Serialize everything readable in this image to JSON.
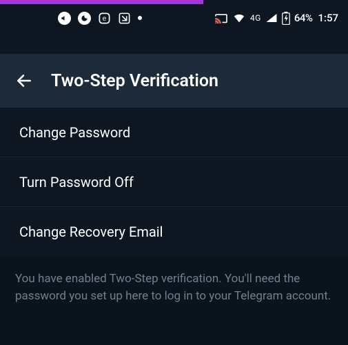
{
  "status": {
    "icons": {
      "mute": "mute-icon",
      "moon": "moon-icon",
      "e": "e",
      "box": "box-icon",
      "cast": "cast-icon",
      "wifi": "wifi-icon",
      "network_label": "4G",
      "signal": "signal-icon",
      "battery": "battery-charging-icon"
    },
    "battery_pct": "64%",
    "clock": "1:57"
  },
  "appbar": {
    "title": "Two-Step Verification"
  },
  "list": {
    "items": [
      {
        "label": "Change Password"
      },
      {
        "label": "Turn Password Off"
      },
      {
        "label": "Change Recovery Email"
      }
    ]
  },
  "footer": {
    "text": "You have enabled Two-Step verification. You'll need the password you set up here to log in to your Telegram account."
  }
}
